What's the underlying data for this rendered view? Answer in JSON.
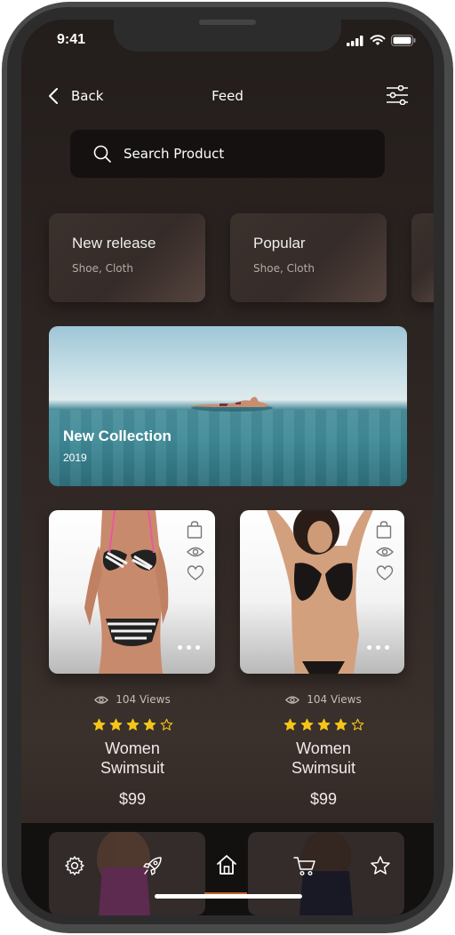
{
  "status_bar": {
    "time": "9:41"
  },
  "header": {
    "back_label": "Back",
    "title": "Feed"
  },
  "search": {
    "placeholder": "Search Product"
  },
  "categories": [
    {
      "title": "New release",
      "subtitle": "Shoe, Cloth"
    },
    {
      "title": "Popular",
      "subtitle": "Shoe, Cloth"
    }
  ],
  "banner": {
    "title": "New Collection",
    "year": "2019"
  },
  "products": [
    {
      "views": "104 Views",
      "rating": 4,
      "rating_max": 5,
      "name_line1": "Women",
      "name_line2": "Swimsuit",
      "price": "$99"
    },
    {
      "views": "104 Views",
      "rating": 4,
      "rating_max": 5,
      "name_line1": "Women",
      "name_line2": "Swimsuit",
      "price": "$99"
    }
  ],
  "bottom_nav": {
    "items": [
      "gear-icon",
      "rocket-icon",
      "home-icon",
      "cart-icon",
      "star-icon"
    ],
    "active": "home-icon"
  },
  "colors": {
    "star": "#f5c518",
    "accent": "#c0622b",
    "background": "#2d2522"
  }
}
